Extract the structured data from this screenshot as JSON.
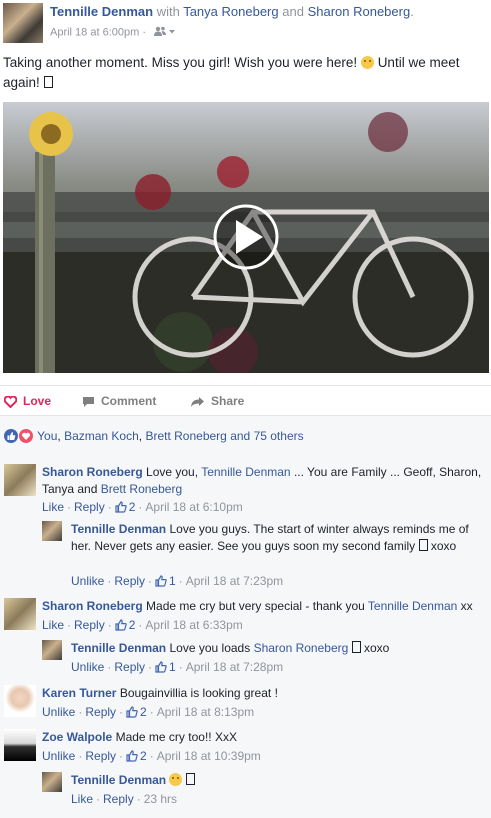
{
  "post": {
    "author": "Tennille Denman",
    "with_word": "with",
    "and_word": "and",
    "tagged_1": "Tanya Roneberg",
    "tagged_2": "Sharon Roneberg",
    "period": ".",
    "timestamp": "April 18 at 6:00pm",
    "sep": "·",
    "text_part1": "Taking another moment. Miss you girl! Wish you were here!",
    "text_part2": "Until we meet again!"
  },
  "actions": {
    "love": "Love",
    "comment": "Comment",
    "share": "Share"
  },
  "reactions": {
    "you": "You",
    "sep1": ",",
    "person1": "Bazman Koch",
    "sep2": ",",
    "person2": "Brett Roneberg",
    "and_word": "and",
    "others": "75 others"
  },
  "comments": [
    {
      "author": "Sharon Roneberg",
      "text_1": "Love you,",
      "mention": "Tennille Denman",
      "text_2": "... You are Family ... Geoff, Sharon, Tanya and",
      "mention_2": "Brett Roneberg",
      "action": "Like",
      "reply": "Reply",
      "likes": "2",
      "time": "April 18 at 6:10pm"
    },
    {
      "author": "Tennille Denman",
      "text_1": "Love you guys. The start of winter always reminds me of her. Never gets any easier. See you guys soon my second family",
      "text_2": "xoxo",
      "action": "Unlike",
      "reply": "Reply",
      "likes": "1",
      "time": "April 18 at 7:23pm"
    },
    {
      "author": "Sharon Roneberg",
      "text_1": "Made me cry but very special - thank you",
      "mention": "Tennille Denman",
      "text_2": "xx",
      "action": "Like",
      "reply": "Reply",
      "likes": "2",
      "time": "April 18 at 6:33pm"
    },
    {
      "author": "Tennille Denman",
      "text_1": "Love you loads",
      "mention": "Sharon Roneberg",
      "text_2": "xoxo",
      "action": "Unlike",
      "reply": "Reply",
      "likes": "1",
      "time": "April 18 at 7:28pm"
    },
    {
      "author": "Karen Turner",
      "text_1": "Bougainvillia is looking great !",
      "action": "Unlike",
      "reply": "Reply",
      "likes": "2",
      "time": "April 18 at 8:13pm"
    },
    {
      "author": "Zoe Walpole",
      "text_1": "Made me cry too!! XxX",
      "action": "Unlike",
      "reply": "Reply",
      "likes": "2",
      "time": "April 18 at 10:39pm"
    },
    {
      "author": "Tennille Denman",
      "action": "Like",
      "reply": "Reply",
      "time": "23 hrs"
    }
  ],
  "colors": {
    "link": "#365899",
    "love": "#e0245e",
    "muted": "#90949c",
    "panel": "#f6f7f9"
  }
}
